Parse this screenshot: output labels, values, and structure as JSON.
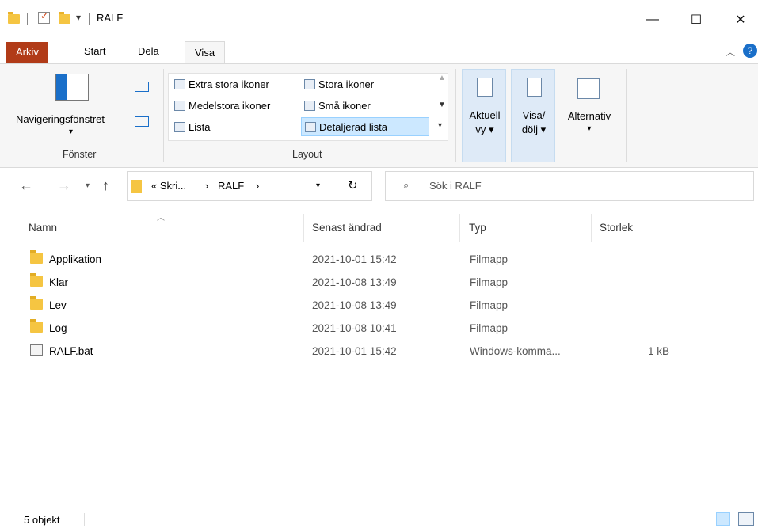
{
  "window": {
    "title": "RALF",
    "minimize": "—",
    "maximize": "☐",
    "close": "✕"
  },
  "tabs": [
    "Arkiv",
    "Start",
    "Dela",
    "Visa"
  ],
  "ribbon": {
    "fonster": {
      "nav_pane_label": "Navigeringsfönstret",
      "group_label": "Fönster"
    },
    "layout": {
      "items": [
        "Extra stora ikoner",
        "Stora ikoner",
        "Medelstora ikoner",
        "Små ikoner",
        "Lista",
        "Detaljerad lista"
      ],
      "selected": "Detaljerad lista",
      "group_label": "Layout"
    },
    "current_view": {
      "line1": "Aktuell",
      "line2": "vy ▾"
    },
    "show_hide": {
      "line1": "Visa/",
      "line2": "dölj ▾"
    },
    "options": {
      "label": "Alternativ"
    }
  },
  "nav": {
    "path": [
      "« Skri...",
      "RALF"
    ],
    "search_placeholder": "Sök i RALF"
  },
  "columns": [
    "Namn",
    "Senast ändrad",
    "Typ",
    "Storlek"
  ],
  "files": [
    {
      "name": "Applikation",
      "date": "2021-10-01 15:42",
      "type": "Filmapp",
      "size": "",
      "kind": "folder"
    },
    {
      "name": "Klar",
      "date": "2021-10-08 13:49",
      "type": "Filmapp",
      "size": "",
      "kind": "folder"
    },
    {
      "name": "Lev",
      "date": "2021-10-08 13:49",
      "type": "Filmapp",
      "size": "",
      "kind": "folder"
    },
    {
      "name": "Log",
      "date": "2021-10-08 10:41",
      "type": "Filmapp",
      "size": "",
      "kind": "folder"
    },
    {
      "name": "RALF.bat",
      "date": "2021-10-01 15:42",
      "type": "Windows-komma...",
      "size": "1 kB",
      "kind": "bat"
    }
  ],
  "status": {
    "count": "5 objekt"
  },
  "colors": {
    "arkiv_tab": "#b13b18",
    "folder": "#f5c542",
    "selected_bg": "#cce8ff"
  }
}
